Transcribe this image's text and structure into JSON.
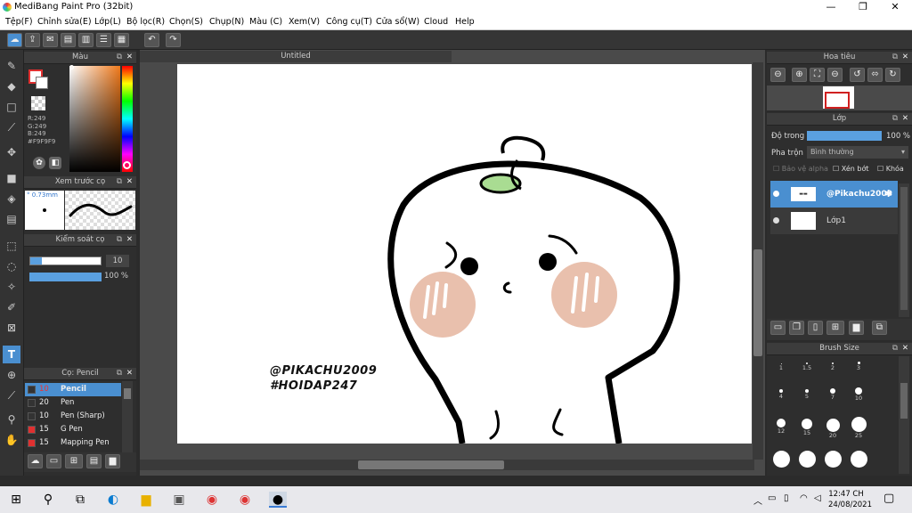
{
  "window": {
    "title": "MediBang Paint Pro (32bit)",
    "min": "—",
    "max": "❐",
    "close": "✕"
  },
  "menu": [
    "Tệp(F)",
    "Chỉnh sửa(E)",
    "Lớp(L)",
    "Bộ lọc(R)",
    "Chọn(S)",
    "Chụp(N)",
    "Màu (C)",
    "Xem(V)",
    "Công cụ(T)",
    "Cửa sổ(W)",
    "Cloud",
    "Help"
  ],
  "color_panel": {
    "title": "Màu",
    "r": "R:249",
    "g": "G:249",
    "b": "B:249",
    "hex": "#F9F9F9"
  },
  "brush_preview": {
    "title": "Xem trước cọ",
    "size": "0.73mm"
  },
  "brush_control": {
    "title": "Kiểm soát cọ",
    "size_value": "10",
    "opacity_value": "100 %"
  },
  "brush_list": {
    "title": "Cọ: Pencil",
    "items": [
      {
        "size": "10",
        "name": "Pencil",
        "color": "#333333"
      },
      {
        "size": "20",
        "name": "Pen",
        "color": "#333333"
      },
      {
        "size": "10",
        "name": "Pen (Sharp)",
        "color": "#333333"
      },
      {
        "size": "15",
        "name": "G Pen",
        "color": "#e03030"
      },
      {
        "size": "15",
        "name": "Mapping Pen",
        "color": "#e03030"
      }
    ]
  },
  "canvas": {
    "tab": "Untitled",
    "text1": "@PIKACHU2009",
    "text2": "#HOIDAP247"
  },
  "navigator": {
    "title": "Hoa tiêu"
  },
  "layers": {
    "title": "Lớp",
    "opacity_label": "Độ trong",
    "opacity_value": "100 %",
    "blend_label": "Pha trộn",
    "blend_value": "Bình thường",
    "protect_alpha": "Bảo vệ alpha",
    "clipping": "Xén bớt",
    "lock": "Khóa",
    "items": [
      {
        "name": "@Pikachu2009"
      },
      {
        "name": "Lớp1"
      }
    ]
  },
  "brush_size": {
    "title": "Brush Size",
    "labels": [
      "1",
      "1.5",
      "2",
      "3",
      "4",
      "5",
      "7",
      "10",
      "12",
      "15",
      "20",
      "25"
    ]
  },
  "taskbar": {
    "time": "12:47 CH",
    "date": "24/08/2021",
    "search_icon": "search-icon",
    "windows_icon": "windows-icon"
  }
}
